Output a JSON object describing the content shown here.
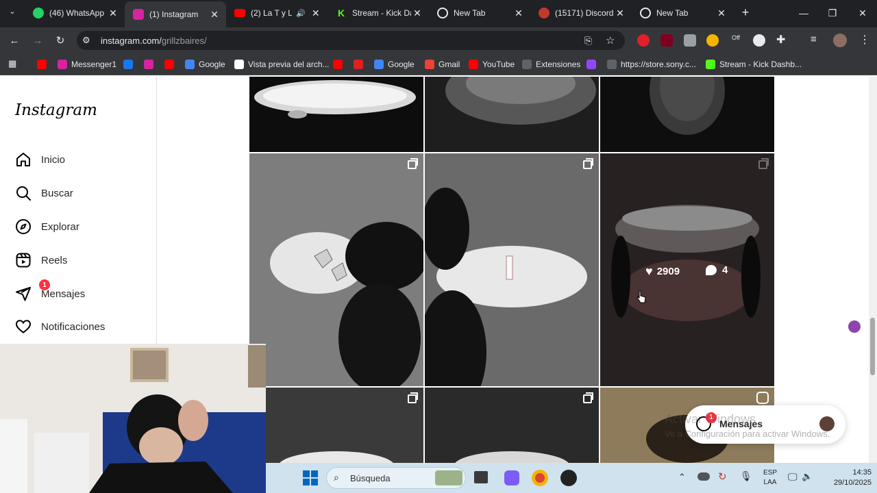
{
  "browser": {
    "tabs": [
      {
        "label": "(46) WhatsApp",
        "color": "#25d366",
        "glyph": "W"
      },
      {
        "label": "(1) Instagram",
        "color": "#d6249f",
        "glyph": "◎"
      },
      {
        "label": "(2) La T y La",
        "color": "#ff0000",
        "glyph": "▶"
      },
      {
        "label": "Stream - Kick Da",
        "color": "#53fc18",
        "glyph": "K"
      },
      {
        "label": "New Tab",
        "color": "#5f6368",
        "glyph": "●"
      },
      {
        "label": "(15171) Discord",
        "color": "#c0392b",
        "glyph": "D"
      },
      {
        "label": "New Tab",
        "color": "#5f6368",
        "glyph": "●"
      }
    ],
    "address": {
      "host": "instagram.com/",
      "path": "grillzbaires/"
    },
    "bookmarks": [
      {
        "label": "",
        "color": "#ff0000",
        "glyph": "▶"
      },
      {
        "label": "Messenger1",
        "color": "#d6249f",
        "glyph": "◎"
      },
      {
        "label": "",
        "color": "#1877f2",
        "glyph": "f"
      },
      {
        "label": "",
        "color": "#d6249f",
        "glyph": "◎"
      },
      {
        "label": "",
        "color": "#ff0000",
        "glyph": "▶"
      },
      {
        "label": "Google",
        "color": "#4285f4",
        "glyph": "G"
      },
      {
        "label": "Vista previa del arch...",
        "color": "#ffffff",
        "glyph": "◐"
      },
      {
        "label": "",
        "color": "#ff0000",
        "glyph": "▶"
      },
      {
        "label": "",
        "color": "#e02020",
        "glyph": "●"
      },
      {
        "label": "Google",
        "color": "#4285f4",
        "glyph": "G"
      },
      {
        "label": "Gmail",
        "color": "#ea4335",
        "glyph": "M"
      },
      {
        "label": "YouTube",
        "color": "#ff0000",
        "glyph": "▶"
      },
      {
        "label": "Extensiones",
        "color": "#5f6368",
        "glyph": "✚"
      },
      {
        "label": "",
        "color": "#9146ff",
        "glyph": "T"
      },
      {
        "label": "https://store.sony.c...",
        "color": "#5f6368",
        "glyph": "S"
      },
      {
        "label": "Stream - Kick Dashb...",
        "color": "#53fc18",
        "glyph": "K"
      }
    ]
  },
  "sidebar": {
    "logo": "Instagram",
    "items": [
      {
        "label": "Inicio",
        "icon": "home-icon"
      },
      {
        "label": "Buscar",
        "icon": "search-icon"
      },
      {
        "label": "Explorar",
        "icon": "compass-icon"
      },
      {
        "label": "Reels",
        "icon": "reels-icon"
      },
      {
        "label": "Mensajes",
        "icon": "messenger-icon",
        "badge": "1"
      },
      {
        "label": "Notificaciones",
        "icon": "heart-icon"
      }
    ]
  },
  "grid": {
    "hover_stats": {
      "likes": "2909",
      "comments": "4"
    }
  },
  "messages_pill": {
    "label": "Mensajes",
    "badge": "1"
  },
  "watermark": {
    "title": "Activar Windows",
    "subtitle": "Ve a Configuración para activar Windows."
  },
  "taskbar": {
    "search_placeholder": "Búsqueda",
    "lang_top": "ESP",
    "lang_bottom": "LAA",
    "time": "14:35",
    "date": "29/10/2025"
  }
}
